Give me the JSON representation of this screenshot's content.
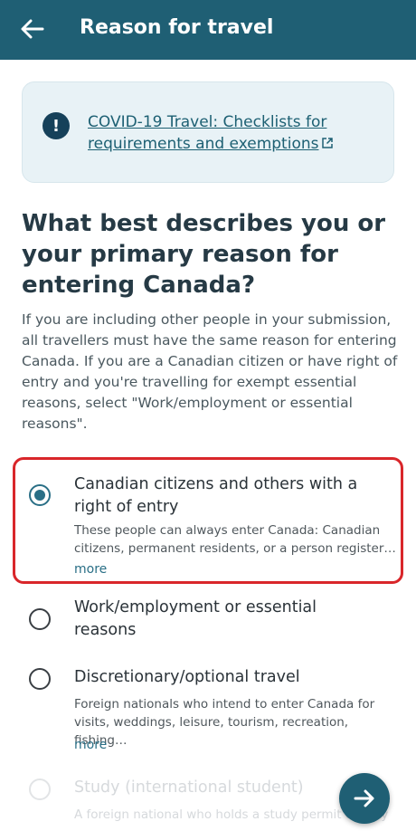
{
  "header": {
    "title": "Reason for travel",
    "back_icon": "arrow-left-icon"
  },
  "banner": {
    "icon": "exclamation-icon",
    "link_text": "COVID-19 Travel: Checklists for requirements and exemptions",
    "external_icon": "external-link-icon"
  },
  "question": {
    "title": "What best describes you or your primary reason for entering Canada?",
    "description": "If you are including other people in your submission, all travellers must have the same reason for entering Canada. If you are a Canadian citizen or have right of entry and you're travelling for exempt essential reasons, select \"Work/employment or essential reasons\"."
  },
  "options": [
    {
      "title": "Canadian citizens and others with a right of entry",
      "subtitle": "These people can always enter Canada: Canadian citizens, permanent residents, or a person register…",
      "more": "more",
      "selected": true
    },
    {
      "title": "Work/employment or essential reasons",
      "selected": false
    },
    {
      "title": "Discretionary/optional travel",
      "subtitle": "Foreign nationals who intend to enter Canada for visits, weddings, leisure, tourism, recreation, fishing…",
      "more": "more",
      "selected": false
    },
    {
      "title": "Study (international student)",
      "subtitle": "A foreign national who holds a study permit or may",
      "selected": false
    }
  ],
  "fab": {
    "icon": "arrow-right-icon"
  },
  "colors": {
    "app_bar": "#1f5f74",
    "selected_border": "#d9262a",
    "radio_selected": "#2a6f86",
    "banner_bg": "#e8f2f6"
  }
}
